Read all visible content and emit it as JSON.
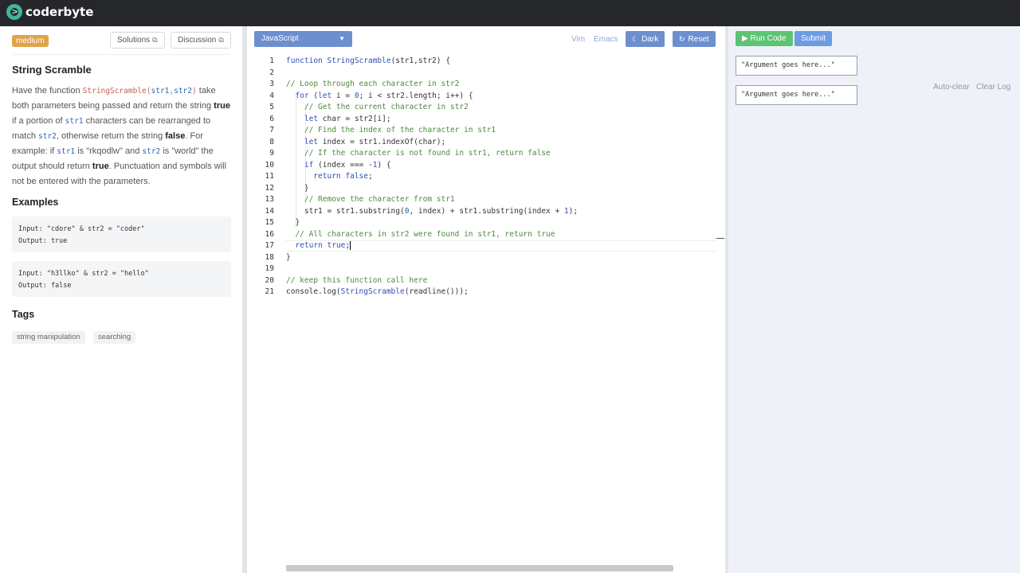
{
  "app": {
    "logo_glyph": ">",
    "logo_text": "coderbyte"
  },
  "problem": {
    "difficulty": "medium",
    "solutions_label": "Solutions",
    "discussion_label": "Discussion",
    "external_glyph": "⧉",
    "title": "String Scramble",
    "desc": {
      "p1": "Have the function ",
      "fn": "StringScramble(",
      "a1": "str1",
      "comma": ",",
      "a2": "str2",
      "close": ")",
      "p2": " take both parameters being passed and return the string ",
      "true": "true",
      "p3": " if a portion of ",
      "a3": "str1",
      "p4": " characters can be rearranged to match ",
      "a4": "str2",
      "p5": ", otherwise return the string ",
      "false": "false",
      "p6": ". For example: if ",
      "a5": "str1",
      "p7": " is \"rkqodlw\" and ",
      "a6": "str2",
      "p8": " is \"world\" the output should return ",
      "true2": "true",
      "p9": ". Punctuation and symbols will not be entered with the parameters."
    },
    "examples_heading": "Examples",
    "examples": [
      {
        "input": "Input: \"cdore\" & str2 = \"coder\"",
        "output": "Output: true"
      },
      {
        "input": "Input: \"h3llko\" & str2 = \"hello\"",
        "output": "Output: false"
      }
    ],
    "tags_heading": "Tags",
    "tags": [
      "string manipulation",
      "searching"
    ]
  },
  "editor": {
    "language": "JavaScript",
    "caret_glyph": "▼",
    "vim_label": "Vim",
    "emacs_label": "Emacs",
    "dark_label": "Dark",
    "dark_icon": "☾",
    "reset_label": "Reset",
    "reset_icon": "↻",
    "lines": [
      "function StringScramble(str1,str2) {",
      "",
      "// Loop through each character in str2",
      "  for (let i = 0; i < str2.length; i++) {",
      "    // Get the current character in str2",
      "    let char = str2[i];",
      "    // Find the index of the character in str1",
      "    let index = str1.indexOf(char);",
      "    // If the character is not found in str1, return false",
      "    if (index === -1) {",
      "      return false;",
      "    }",
      "    // Remove the character from str1",
      "    str1 = str1.substring(0, index) + str1.substring(index + 1);",
      "  }",
      "  // All characters in str2 were found in str1, return true",
      "  return true;",
      "}",
      "",
      "// keep this function call here",
      "console.log(StringScramble(readline()));"
    ]
  },
  "runner": {
    "run_label": "Run Code",
    "run_icon": "▶",
    "submit_label": "Submit",
    "arg1_placeholder": "\"Argument goes here...\"",
    "arg2_placeholder": "\"Argument goes here...\"",
    "auto_clear_label": "Auto-clear",
    "clear_log_label": "Clear Log"
  }
}
